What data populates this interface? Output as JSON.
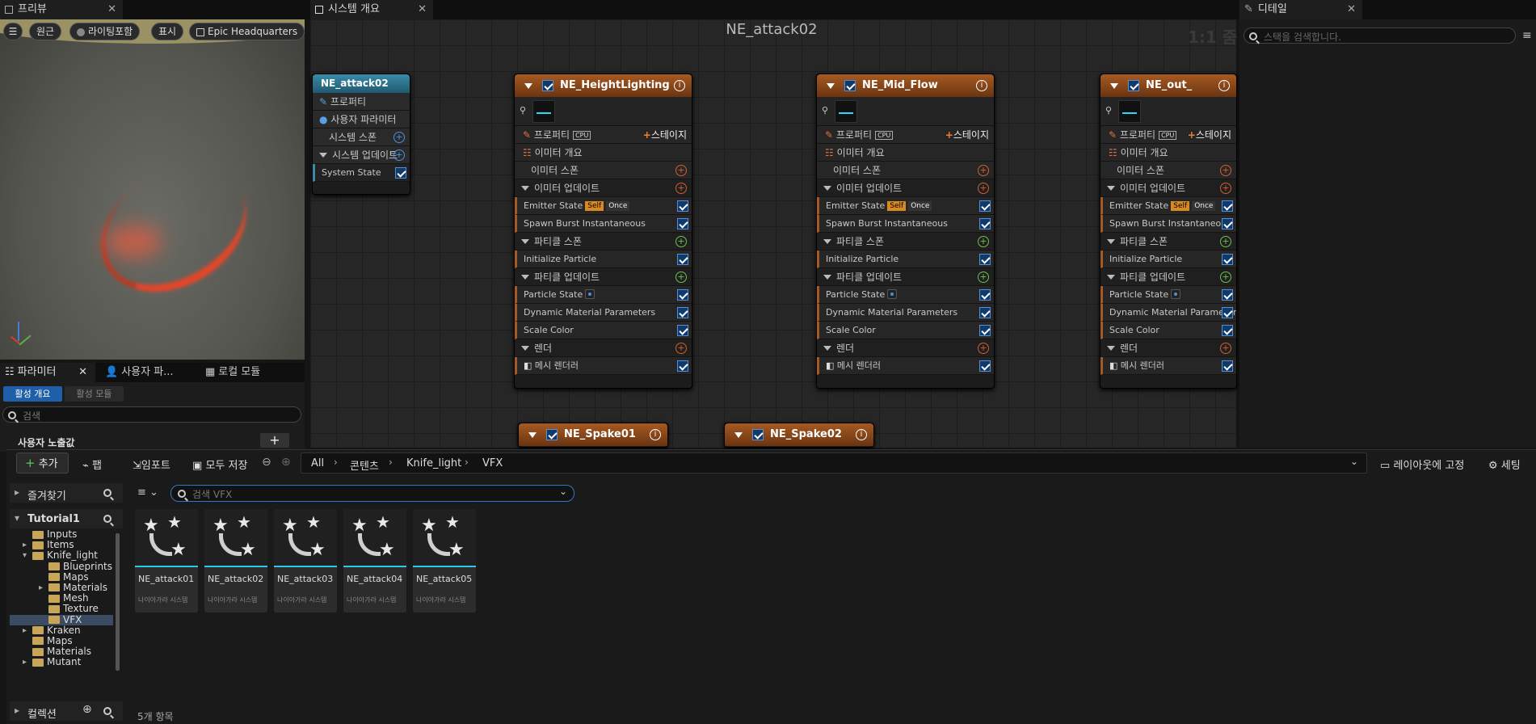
{
  "tabs": {
    "preview": "프리뷰",
    "system_overview": "시스템 개요",
    "details": "디테일",
    "parameters": "파라미터",
    "user_params": "사용자 파...",
    "local_modules": "로컬 모듈"
  },
  "viewport_toolbar": {
    "perspective": "원근",
    "lighting": "라이팅포함",
    "show": "표시",
    "environment": "Epic Headquarters"
  },
  "graph": {
    "title": "NE_attack02",
    "zoom": "1:1 줌"
  },
  "details": {
    "search_placeholder": "스택을 검색합니다."
  },
  "system_node": {
    "title": "NE_attack02",
    "properties": "프로퍼티",
    "user_params": "사용자 파라미터",
    "system_spawn": "시스템 스폰",
    "system_update": "시스템 업데이트",
    "system_state": "System State"
  },
  "emitter_labels": {
    "properties": "프로퍼티",
    "cpu": "CPU",
    "stage": "스테이지",
    "emitter_summary": "이미터 개요",
    "emitter_spawn": "이미터 스폰",
    "emitter_update": "이미터 업데이트",
    "emitter_state": "Emitter State",
    "self": "Self",
    "once": "Once",
    "spawn_burst": "Spawn Burst Instantaneous",
    "particle_spawn": "파티클 스폰",
    "init_particle": "Initialize Particle",
    "particle_update": "파티클 업데이트",
    "particle_state": "Particle State",
    "dynamic_mat": "Dynamic Material Parameters",
    "scale_color": "Scale Color",
    "render": "렌더",
    "mesh_renderer": "메시 렌더러"
  },
  "emitters": [
    {
      "name": "NE_HeightLighting"
    },
    {
      "name": "NE_Mid_Flow"
    },
    {
      "name": "NE_out_"
    }
  ],
  "small_emitters": [
    {
      "name": "NE_Spake01"
    },
    {
      "name": "NE_Spake02"
    }
  ],
  "params_panel": {
    "active_overview": "활성 개요",
    "active_modules": "활성 모듈",
    "search_placeholder": "검색",
    "user_exposed": "사용자 노출값"
  },
  "content_browser": {
    "add": "추가",
    "import_btn": "임포트",
    "fab": "팹",
    "save_all": "모두 저장",
    "breadcrumb": [
      "All",
      "콘텐츠",
      "Knife_light",
      "VFX"
    ],
    "lock_layout": "레이아웃에 고정",
    "settings": "세팅",
    "favorites": "즐겨찾기",
    "project": "Tutorial1",
    "search_placeholder": "검색 VFX",
    "collections": "컬렉션",
    "item_count": "5개 항목",
    "tree": [
      {
        "label": "Inputs"
      },
      {
        "label": "Items"
      },
      {
        "label": "Knife_light"
      },
      {
        "label": "Blueprints"
      },
      {
        "label": "Maps"
      },
      {
        "label": "Materials"
      },
      {
        "label": "Mesh"
      },
      {
        "label": "Texture"
      },
      {
        "label": "VFX"
      },
      {
        "label": "Kraken"
      },
      {
        "label": "Maps"
      },
      {
        "label": "Materials"
      },
      {
        "label": "Mutant"
      }
    ],
    "assets": [
      {
        "name": "NE_attack01",
        "type": "나이아가라 시스템"
      },
      {
        "name": "NE_attack02",
        "type": "나이아가라 시스템"
      },
      {
        "name": "NE_attack03",
        "type": "나이아가라 시스템"
      },
      {
        "name": "NE_attack04",
        "type": "나이아가라 시스템"
      },
      {
        "name": "NE_attack05",
        "type": "나이아가라 시스템"
      }
    ]
  },
  "colors": {
    "emitter_header": "#a65a23",
    "system_header": "#2e6e86",
    "accent_blue": "#1f5ea8",
    "asset_bar": "#2fc8e8"
  }
}
